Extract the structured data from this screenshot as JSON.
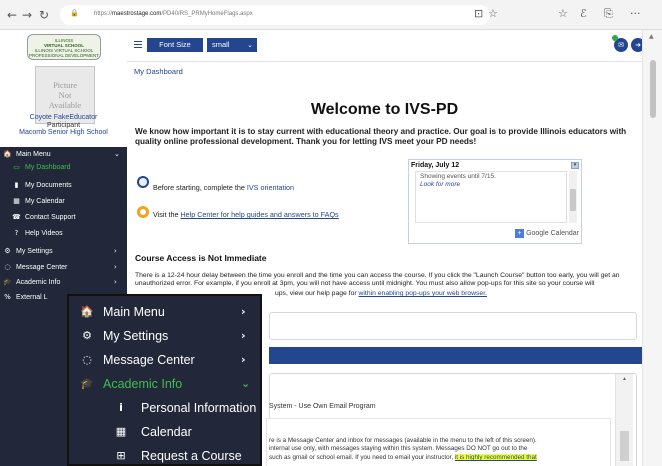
{
  "browser": {
    "back_icon": "back-arrow-icon",
    "url_prefix": "https://",
    "url_host": "maestrostage.com",
    "url_path": "/PD40/RS_PRMyHomeFlags.aspx",
    "nav_glyphs": {
      "back": "←",
      "forward": "→",
      "reload": "↻",
      "lock": "🔒"
    },
    "toolbar_glyphs": {
      "reader": "⊡",
      "star": "☆",
      "favorites": "☆",
      "profile": "ℰ",
      "share": "⎘",
      "more": "···"
    }
  },
  "sidebar": {
    "logo_lines": [
      "ILLINOIS",
      "VIRTUAL SCHOOL",
      "ILLINOIS VIRTUAL SCHOOL",
      "PROFESSIONAL DEVELOPMENT"
    ],
    "picture_placeholder": [
      "Picture",
      "Not",
      "Available"
    ],
    "user_name": "Coyote FakeEducator",
    "user_role": "Participant",
    "user_school": "Macomb Senior High School",
    "items": [
      {
        "icon": "home-icon",
        "glyph": "🏠",
        "label": "Main Menu",
        "chevron": "⌄"
      },
      {
        "icon": "monitor-icon",
        "glyph": "▭",
        "label": "My Dashboard",
        "active": true
      },
      {
        "icon": "document-icon",
        "glyph": "▮",
        "label": "My Documents"
      },
      {
        "icon": "calendar-icon",
        "glyph": "▦",
        "label": "My Calendar"
      },
      {
        "icon": "phone-icon",
        "glyph": "☎",
        "label": "Contact Support"
      },
      {
        "icon": "help-icon",
        "glyph": "?",
        "label": "Help Videos"
      },
      {
        "icon": "settings-icon",
        "glyph": "⚙",
        "label": "My Settings",
        "chevron": "›"
      },
      {
        "icon": "chat-icon",
        "glyph": "◌",
        "label": "Message Center",
        "chevron": "›"
      },
      {
        "icon": "graduation-cap-icon",
        "glyph": "🎓",
        "label": "Academic Info",
        "chevron": "›"
      },
      {
        "icon": "link-icon",
        "glyph": "%",
        "label": "External L"
      }
    ]
  },
  "topbar": {
    "font_size_label": "Font Size",
    "font_size_value": "small",
    "dropdown_glyph": "⌄",
    "messages_badge_color": "#2ea84c"
  },
  "main": {
    "breadcrumb": "My Dashboard",
    "title": "Welcome to IVS-PD",
    "intro": "We know how important it is to stay current with educational theory and practice. Our goal is to provide Illinois educators with quality online professional development. Thank you for letting IVS meet your PD needs!",
    "orientation_prefix": "Before starting, complete the ",
    "orientation_link": "IVS orientation",
    "help_prefix": "Visit the ",
    "help_link": "Help Center for help guides and answers to FAQs",
    "access_title": "Course Access is Not Immediate",
    "access_text_1": "There is a 12-24 hour delay between the time you enroll and the time you can access the course. If you click the \"Launch Course\" button too early, you will get an unauthorized error. For example, if you enroll at 3pm, you will not have access until midnight. You must also allow pop-ups for this site so your course will",
    "access_text_2_visible": "ups, view our help page for ",
    "access_link": "within enabling pop-ups your web browser.",
    "email_line": "System - Use Own Email Program",
    "msg_line_1": "re is a Message Center and inbox for messages (available in the menu to the left of this screen).",
    "msg_line_2": "internal use only, with messages staying within this system.  Messages DO NOT go out to the",
    "msg_line_3_prefix": "such as gmail or school email. If you need to email your instructor, ",
    "msg_line_3_highlight": "it is highly recommended that"
  },
  "calendar": {
    "date": "Friday, July 12",
    "no_events": "Showing events until 7/15.",
    "look_more": "Look for more",
    "google_label": "Google Calendar"
  },
  "overlay": {
    "items": [
      {
        "icon": "home-icon",
        "glyph": "🏠",
        "label": "Main Menu",
        "chevron": "›"
      },
      {
        "icon": "settings-icon",
        "glyph": "⚙",
        "label": "My Settings",
        "chevron": "›"
      },
      {
        "icon": "chat-icon",
        "glyph": "◌",
        "label": "Message Center",
        "chevron": "›"
      },
      {
        "icon": "graduation-cap-icon",
        "glyph": "🎓",
        "label": "Academic Info",
        "chevron": "⌄",
        "active": true
      },
      {
        "icon": "info-icon",
        "glyph": "i",
        "label": "Personal Information"
      },
      {
        "icon": "calendar-icon",
        "glyph": "▦",
        "label": "Calendar"
      },
      {
        "icon": "plus-square-icon",
        "glyph": "⊞",
        "label": "Request a Course"
      }
    ]
  },
  "colors": {
    "nav_bg": "#22283a",
    "accent_blue": "#24468f",
    "active_green": "#3fbe4d",
    "highlight": "#f1ff38"
  }
}
